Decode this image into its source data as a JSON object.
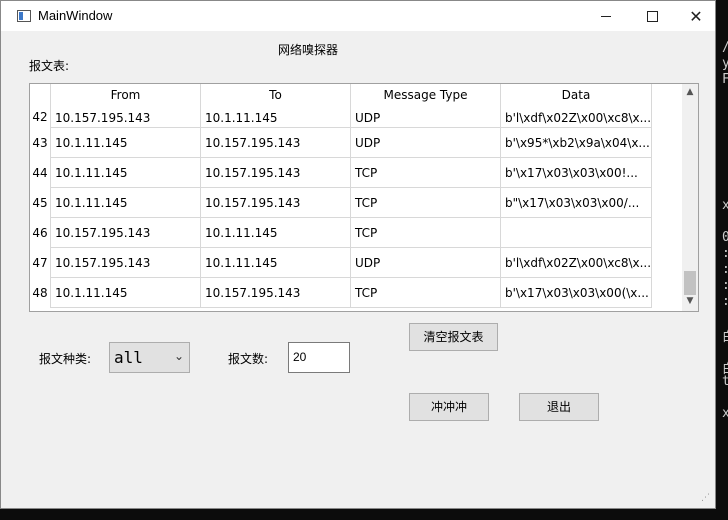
{
  "window": {
    "title": "MainWindow",
    "heading": "网络嗅探器",
    "table_label": "报文表:"
  },
  "table": {
    "columns": [
      "From",
      "To",
      "Message Type",
      "Data"
    ],
    "rows": [
      {
        "num": "42",
        "from": "10.157.195.143",
        "to": "10.1.11.145",
        "type": "UDP",
        "data": "b'l\\xdf\\x02Z\\x00\\xc8\\x..."
      },
      {
        "num": "43",
        "from": "10.1.11.145",
        "to": "10.157.195.143",
        "type": "UDP",
        "data": "b'\\x95*\\xb2\\x9a\\x04\\x..."
      },
      {
        "num": "44",
        "from": "10.1.11.145",
        "to": "10.157.195.143",
        "type": "TCP",
        "data": "b'\\x17\\x03\\x03\\x00!..."
      },
      {
        "num": "45",
        "from": "10.1.11.145",
        "to": "10.157.195.143",
        "type": "TCP",
        "data": "b\"\\x17\\x03\\x03\\x00/..."
      },
      {
        "num": "46",
        "from": "10.157.195.143",
        "to": "10.1.11.145",
        "type": "TCP",
        "data": ""
      },
      {
        "num": "47",
        "from": "10.157.195.143",
        "to": "10.1.11.145",
        "type": "UDP",
        "data": "b'l\\xdf\\x02Z\\x00\\xc8\\x..."
      },
      {
        "num": "48",
        "from": "10.1.11.145",
        "to": "10.157.195.143",
        "type": "TCP",
        "data": "b'\\x17\\x03\\x03\\x00(\\x..."
      }
    ]
  },
  "controls": {
    "clear_label": "清空报文表",
    "type_label": "报文种类:",
    "type_value": "all",
    "count_label": "报文数:",
    "count_value": "20",
    "go_label": "冲冲冲",
    "exit_label": "退出"
  }
}
